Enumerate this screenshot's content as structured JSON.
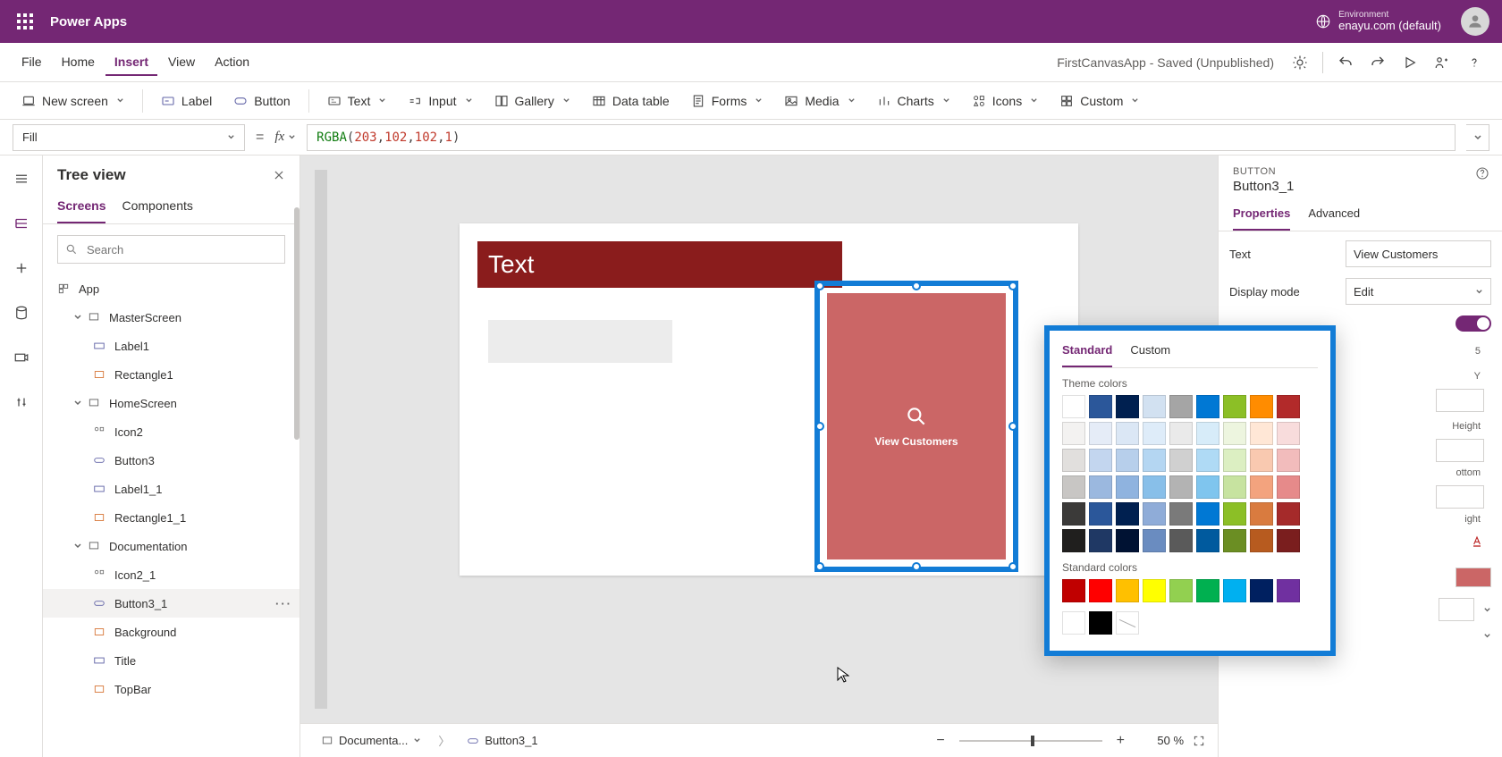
{
  "header": {
    "app_name": "Power Apps",
    "environment_label": "Environment",
    "environment_value": "enayu.com (default)"
  },
  "menubar": {
    "items": [
      "File",
      "Home",
      "Insert",
      "View",
      "Action"
    ],
    "active": "Insert",
    "doc_status": "FirstCanvasApp - Saved (Unpublished)"
  },
  "ribbon": {
    "new_screen": "New screen",
    "label": "Label",
    "button": "Button",
    "text": "Text",
    "input": "Input",
    "gallery": "Gallery",
    "data_table": "Data table",
    "forms": "Forms",
    "media": "Media",
    "charts": "Charts",
    "icons": "Icons",
    "custom": "Custom"
  },
  "formula": {
    "property": "Fill",
    "fn": "RGBA",
    "a1": "203",
    "a2": "102",
    "a3": "102",
    "a4": "1"
  },
  "tree": {
    "title": "Tree view",
    "tabs": [
      "Screens",
      "Components"
    ],
    "active_tab": "Screens",
    "search_placeholder": "Search",
    "app_node": "App",
    "nodes": [
      {
        "name": "MasterScreen",
        "children": [
          "Label1",
          "Rectangle1"
        ]
      },
      {
        "name": "HomeScreen",
        "children": [
          "Icon2",
          "Button3",
          "Label1_1",
          "Rectangle1_1"
        ]
      },
      {
        "name": "Documentation",
        "children": [
          "Icon2_1",
          "Button3_1",
          "Background",
          "Title",
          "TopBar"
        ]
      }
    ],
    "selected": "Button3_1"
  },
  "canvas": {
    "title_text": "Text",
    "button_text": "View Customers",
    "breadcrumb_screen": "Documenta...",
    "breadcrumb_control": "Button3_1",
    "zoom": "50",
    "zoom_suffix": "%"
  },
  "properties": {
    "type_label": "BUTTON",
    "control_name": "Button3_1",
    "tabs": [
      "Properties",
      "Advanced"
    ],
    "text_label": "Text",
    "text_value": "View Customers",
    "display_mode_label": "Display mode",
    "display_mode_value": "Edit",
    "peek_labels": [
      "Y",
      "Height",
      "ottom",
      "ight"
    ],
    "peek_letters": [
      "5"
    ]
  },
  "color_picker": {
    "tabs": [
      "Standard",
      "Custom"
    ],
    "theme_label": "Theme colors",
    "standard_label": "Standard colors",
    "theme_rows": [
      [
        "#ffffff",
        "#2b579a",
        "#002050",
        "#d2e1f1",
        "#a5a5a5",
        "#0078d4",
        "#8cbf26",
        "#ff8c00",
        "#b22a2a"
      ],
      [
        "#f3f2f1",
        "#e5ecf7",
        "#dbe7f5",
        "#deecf9",
        "#eaeaea",
        "#d7ecf9",
        "#edf5df",
        "#ffe7d6",
        "#f8dcdc"
      ],
      [
        "#e1dfdd",
        "#c3d6ef",
        "#b7cfeb",
        "#b4d6f2",
        "#d0d0d0",
        "#afdaf5",
        "#dcefc2",
        "#f9c9b0",
        "#f2bcbc"
      ],
      [
        "#c8c6c4",
        "#9bb8df",
        "#8fb3df",
        "#88bfe9",
        "#b3b3b3",
        "#7fc5ee",
        "#c7e3a0",
        "#f3a37e",
        "#e68a8a"
      ],
      [
        "#3b3a39",
        "#2b579a",
        "#002050",
        "#8facd8",
        "#7a7a7a",
        "#0078d4",
        "#8cbf26",
        "#d97b3f",
        "#a52a2a"
      ],
      [
        "#201f1e",
        "#1f3864",
        "#001233",
        "#6a8cc0",
        "#5a5a5a",
        "#005a9e",
        "#6b8e23",
        "#b75b1f",
        "#7a1e1e"
      ]
    ],
    "standard_row": [
      "#c00000",
      "#ff0000",
      "#ffc000",
      "#ffff00",
      "#92d050",
      "#00b050",
      "#00b0f0",
      "#002060",
      "#7030a0"
    ],
    "extra_row": [
      "#ffffff",
      "#000000",
      "nocolor"
    ]
  }
}
